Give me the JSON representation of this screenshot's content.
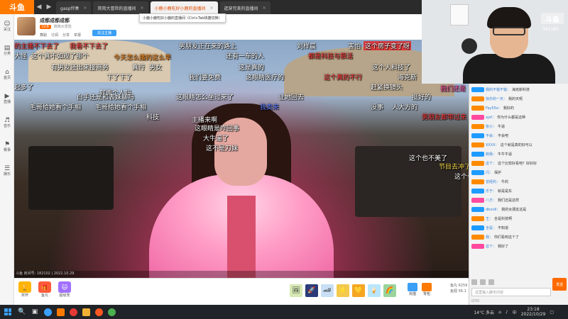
{
  "tabbar": {
    "logo": "斗鱼",
    "tabs": [
      {
        "label": "gasp伴奏"
      },
      {
        "label": "简简大冒险的直播间"
      },
      {
        "label": "小鹿小鹿吃好小鹿的直播间"
      },
      {
        "label": "逛穿完美的直播间"
      }
    ],
    "tooltip": "小鹿小鹿吃好小鹿的直播间（Ctrl+Tab快捷切换）"
  },
  "sidebar": {
    "items": [
      {
        "icon": "☺",
        "label": "关注"
      },
      {
        "icon": "▤",
        "label": "分类"
      },
      {
        "icon": "⌂",
        "label": "首页"
      },
      {
        "icon": "▶",
        "label": "直播"
      },
      {
        "icon": "♬",
        "label": "音乐"
      },
      {
        "icon": "⚑",
        "label": "赛事"
      },
      {
        "icon": "☰",
        "label": "娱乐"
      }
    ]
  },
  "room": {
    "title": "成都成都成都",
    "level": "LV.8",
    "sub": "简简大冒险",
    "follow": "关注主播",
    "meta": [
      "舞蹈",
      "订阅",
      "分享",
      "举报"
    ],
    "footer": "斗鱼 房间号: 182102 | 2022.10.29"
  },
  "danmu": [
    {
      "text": "的主播不下去了",
      "cls": "c-red"
    },
    {
      "text": "我看不下去了",
      "cls": "c-red"
    },
    {
      "text": "男朋友正在来的路上",
      "cls": ""
    },
    {
      "text": "刘样晨",
      "cls": ""
    },
    {
      "text": "害怕",
      "cls": ""
    },
    {
      "text": "这个房子变了呀",
      "cls": "bg-red"
    },
    {
      "text": "大怪",
      "cls": ""
    },
    {
      "text": "这个真不如观了那个",
      "cls": ""
    },
    {
      "text": "还有一车的人",
      "cls": ""
    },
    {
      "text": "都是科技与狠活",
      "cls": "c-red"
    },
    {
      "text": "有男友还出来接商务",
      "cls": ""
    },
    {
      "text": "真行",
      "cls": ""
    },
    {
      "text": "男女",
      "cls": ""
    },
    {
      "text": "这是真的",
      "cls": ""
    },
    {
      "text": "这个人科技了",
      "cls": ""
    },
    {
      "text": "今天怎么播的这么早",
      "cls": "c-orange"
    },
    {
      "text": "下了下了",
      "cls": ""
    },
    {
      "text": "我们要免费",
      "cls": ""
    },
    {
      "text": "这眼睛医疗的",
      "cls": ""
    },
    {
      "text": "这个真的不行",
      "cls": "c-red"
    },
    {
      "text": "海克斯",
      "cls": ""
    },
    {
      "text": "起多了",
      "cls": ""
    },
    {
      "text": "就两个人吗",
      "cls": ""
    },
    {
      "text": "赶紧换镜头",
      "cls": ""
    },
    {
      "text": "我们还是",
      "cls": "c-pink"
    },
    {
      "text": "白手还是和表妹聊吗",
      "cls": ""
    },
    {
      "text": "这眼睛怎么坐过来了",
      "cls": ""
    },
    {
      "text": "让她回去",
      "cls": ""
    },
    {
      "text": "挺好的",
      "cls": ""
    },
    {
      "text": "毛哥给她看个手相",
      "cls": ""
    },
    {
      "text": "毛哥给她看个手相",
      "cls": ""
    },
    {
      "text": "我卖来",
      "cls": "c-blue"
    },
    {
      "text": "没事",
      "cls": ""
    },
    {
      "text": "人大方的",
      "cls": ""
    },
    {
      "text": "科技",
      "cls": ""
    },
    {
      "text": "男朋友都带过来",
      "cls": "c-red"
    },
    {
      "text": "主播来啊",
      "cls": ""
    },
    {
      "text": "这眼睛是咋回事",
      "cls": ""
    },
    {
      "text": "大牛逼了",
      "cls": ""
    },
    {
      "text": "这不是刀妹",
      "cls": ""
    },
    {
      "text": "这个也不美了",
      "cls": ""
    },
    {
      "text": "节目去冲了呀",
      "cls": "c-yellow"
    },
    {
      "text": "这个也改",
      "cls": ""
    }
  ],
  "giftbar": {
    "left": [
      {
        "icon": "🏆",
        "label": "奖杯"
      },
      {
        "icon": "🎁",
        "label": "鱼丸"
      },
      {
        "icon": "🐱",
        "label": "超级宠"
      }
    ],
    "gifts": [
      "🖼",
      "🚀",
      "🏎",
      "⭐",
      "💛",
      "🍦",
      "🌈"
    ],
    "charge": [
      {
        "label": "充值"
      },
      {
        "label": "背包"
      }
    ],
    "stats": [
      "鱼丸 6259",
      "鱼翅 56.1"
    ]
  },
  "webcam": {
    "logo": "斗鱼",
    "id": "341183"
  },
  "chat": {
    "rows": [
      {
        "lvl": "#1e9bff",
        "user": "我的不错不错：",
        "msg": "海克斯科技"
      },
      {
        "lvl": "#ff8a00",
        "user": "快乐的一天：",
        "msg": "我的天呢"
      },
      {
        "lvl": "#ff8a00",
        "user": "Fay55o：",
        "msg": "我好的"
      },
      {
        "lvl": "#ff4aa0",
        "user": "xjxf：",
        "msg": "你为什么都是这种"
      },
      {
        "lvl": "#ff8a00",
        "user": "张小：",
        "msg": "牛逼"
      },
      {
        "lvl": "#1e9bff",
        "user": "不会：",
        "msg": "不会吧"
      },
      {
        "lvl": "#ff8a00",
        "user": "XXXX：",
        "msg": "这个就是真的好可以"
      },
      {
        "lvl": "#1e9bff",
        "user": "她我：",
        "msg": "牛牛牛逼"
      },
      {
        "lvl": "#ff8a00",
        "user": "这个：",
        "msg": "这个比较好看吧？好好好"
      },
      {
        "lvl": "#1e9bff",
        "user": "闪：",
        "msg": "保护"
      },
      {
        "lvl": "#ff8a00",
        "user": "曾经的：",
        "msg": "牛的"
      },
      {
        "lvl": "#1e9bff",
        "user": "乐于：",
        "msg": "就是是东"
      },
      {
        "lvl": "#ff4aa0",
        "user": "八方：",
        "msg": "我们还是这样"
      },
      {
        "lvl": "#1e9bff",
        "user": "dbvidl：",
        "msg": "我的女朋友这是"
      },
      {
        "lvl": "#ff8a00",
        "user": "王：",
        "msg": "全是科技啊"
      },
      {
        "lvl": "#1e9bff",
        "user": "全是：",
        "msg": "不知道"
      },
      {
        "lvl": "#ff8a00",
        "user": "我：",
        "msg": "你们看到这个了"
      },
      {
        "lvl": "#ff4aa0",
        "user": "这个：",
        "msg": "我好了"
      }
    ],
    "input_placeholder": "这里输入聊天内容",
    "send_label": "发送",
    "count": "0/50"
  },
  "taskbar": {
    "icons": [
      "🔍",
      "▣",
      "⬤",
      "🗂",
      "⬤",
      "⬤",
      "⬤"
    ],
    "icon_colors": [
      "#3aa0ff",
      "#ff7a00",
      "#e53935",
      "#ff9800",
      "#ff5722",
      "#4caf50",
      "#2196f3"
    ],
    "weather": "14°C 多云",
    "ime": "中",
    "time": "23:18",
    "date": "2022/10/29"
  }
}
